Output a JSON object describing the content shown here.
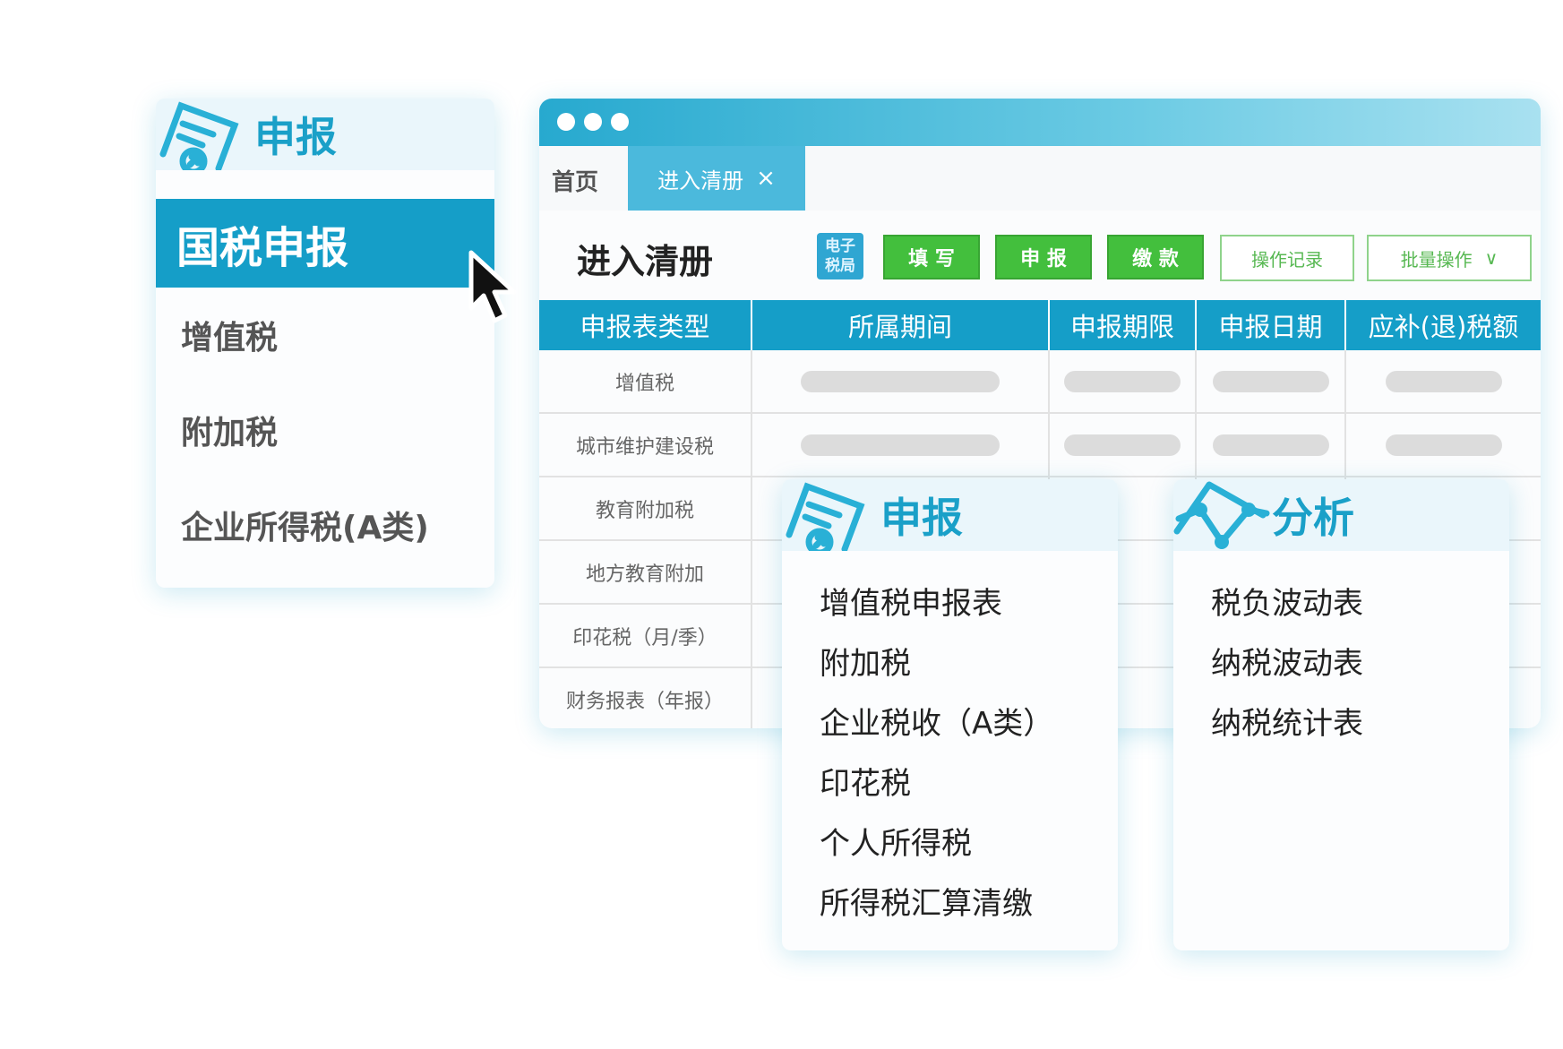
{
  "left_menu": {
    "header": "申报",
    "active_item": "国税申报",
    "items": [
      "增值税",
      "附加税",
      "企业所得税(A类)"
    ]
  },
  "window": {
    "tabs": {
      "home": "首页",
      "active": "进入清册",
      "close": "×"
    },
    "page_title": "进入清册",
    "toolbar": {
      "etax_line1": "电子",
      "etax_line2": "税局",
      "fill": "填 写",
      "declare": "申 报",
      "pay": "缴 款",
      "log": "操作记录",
      "batch": "批量操作",
      "batch_caret": "∨"
    },
    "table": {
      "headers": [
        "申报表类型",
        "所属期间",
        "申报期限",
        "申报日期",
        "应补(退)税额"
      ],
      "rows": [
        "增值税",
        "城市维护建设税",
        "教育附加税",
        "地方教育附加",
        "印花税（月/季）",
        "财务报表（年报）"
      ]
    }
  },
  "report_card": {
    "header": "申报",
    "items": [
      "增值税申报表",
      "附加税",
      "企业税收（A类）",
      "印花税",
      "个人所得税",
      "所得税汇算清缴"
    ]
  },
  "analysis_card": {
    "header": "分析",
    "items": [
      "税负波动表",
      "纳税波动表",
      "纳税统计表"
    ]
  },
  "colors": {
    "accent": "#159ec8",
    "green_button": "#43bf3d",
    "header_tint": "#eaf6fb"
  }
}
